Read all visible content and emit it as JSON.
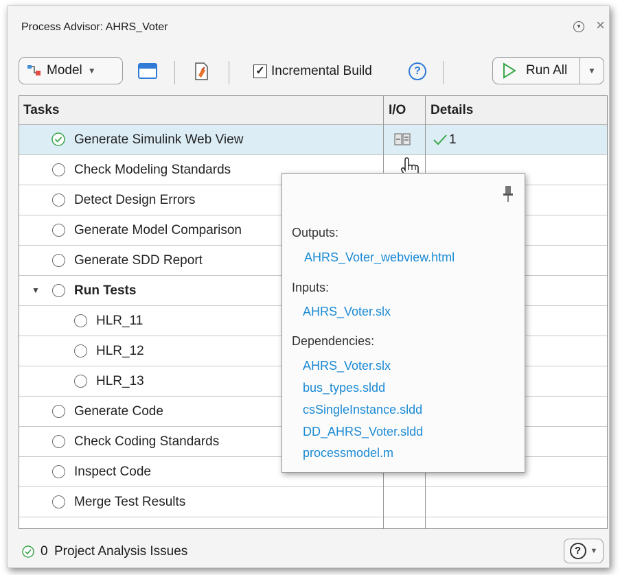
{
  "window": {
    "title": "Process Advisor: AHRS_Voter"
  },
  "toolbar": {
    "model_label": "Model",
    "incremental_build_label": "Incremental Build",
    "incremental_build_checked": true,
    "run_all_label": "Run All"
  },
  "grid": {
    "columns": [
      "Tasks",
      "I/O",
      "Details"
    ],
    "rows": [
      {
        "name": "Generate Simulink Web View",
        "status": "passed",
        "details": "1",
        "selected": true
      },
      {
        "name": "Check Modeling Standards"
      },
      {
        "name": "Detect Design Errors"
      },
      {
        "name": "Generate Model Comparison"
      },
      {
        "name": "Generate SDD Report"
      },
      {
        "name": "Run Tests",
        "group": true
      },
      {
        "name": "HLR_11"
      },
      {
        "name": "HLR_12"
      },
      {
        "name": "HLR_13"
      },
      {
        "name": "Generate Code"
      },
      {
        "name": "Check Coding Standards"
      },
      {
        "name": "Inspect Code"
      },
      {
        "name": "Merge Test Results"
      }
    ]
  },
  "popup": {
    "outputs_label": "Outputs:",
    "outputs": [
      "AHRS_Voter_webview.html"
    ],
    "inputs_label": "Inputs:",
    "inputs": [
      "AHRS_Voter.slx"
    ],
    "dependencies_label": "Dependencies:",
    "dependencies": [
      "AHRS_Voter.slx",
      "bus_types.sldd",
      "csSingleInstance.sldd",
      "DD_AHRS_Voter.sldd",
      "processmodel.m"
    ]
  },
  "status_bar": {
    "count": "0",
    "label": "Project Analysis Issues"
  },
  "colors": {
    "accent": "#1a8ad4",
    "success": "#3aa64a",
    "selected_row": "#dcedf6"
  }
}
